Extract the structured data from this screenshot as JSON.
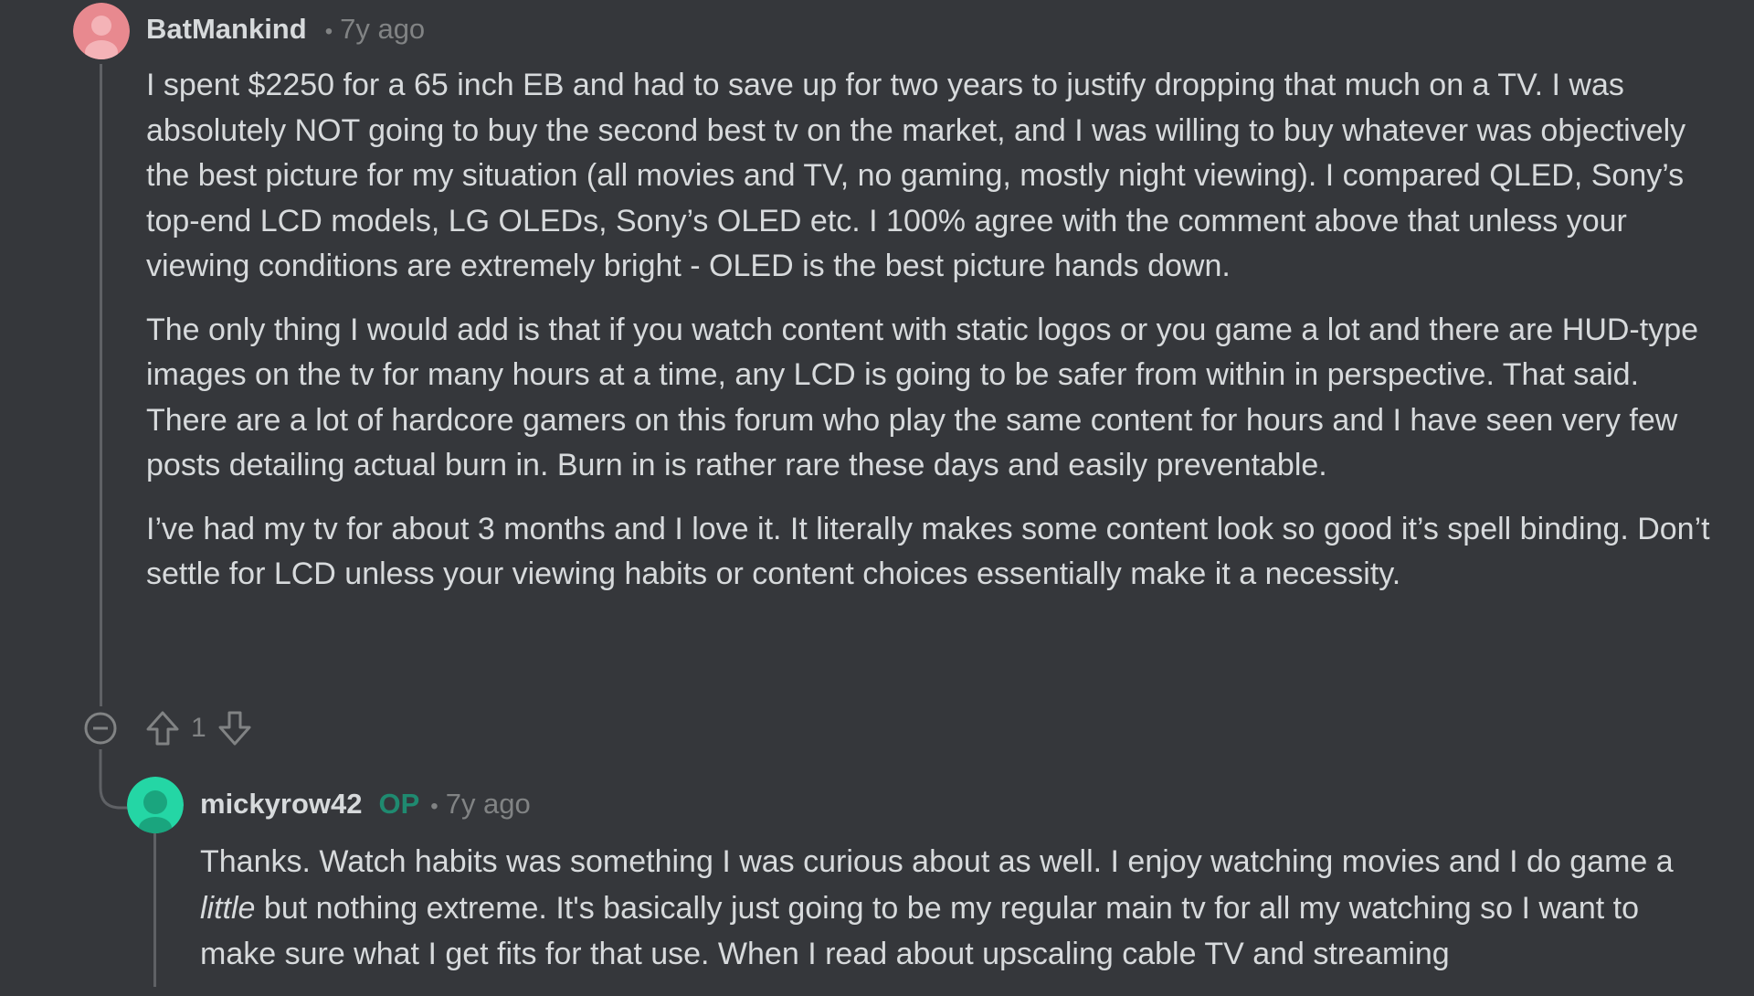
{
  "comments": [
    {
      "author": "BatMankind",
      "time": "7y ago",
      "paragraphs": [
        "I spent $2250 for a 65 inch EB and had to save up for two years to justify dropping that much on a TV. I was absolutely NOT going to buy the second best tv on the market, and I was willing to buy whatever was objectively the best picture for my situation (all movies and TV, no gaming, mostly night viewing). I compared QLED, Sony’s top-end LCD models, LG OLEDs, Sony’s OLED etc. I 100% agree with the comment above that unless your viewing conditions are extremely bright - OLED is the best picture hands down.",
        "The only thing I would add is that if you watch content with static logos or you game a lot and there are HUD-type images on the tv for many hours at a time, any LCD is going to be safer from within in perspective. That said. There are a lot of hardcore gamers on this forum who play the same content for hours and I have seen very few posts detailing actual burn in. Burn in is rather rare these days and easily preventable.",
        "I’ve had my tv for about 3 months and I love it. It literally makes some content look so good it’s spell binding. Don’t settle for LCD unless your viewing habits or content choices essentially make it a necessity."
      ],
      "votes": "1",
      "avatar_color": "#e8898f",
      "icons": {
        "collapse": "collapse-minus-icon",
        "upvote": "upvote-arrow-icon",
        "downvote": "downvote-arrow-icon"
      }
    },
    {
      "author": "mickyrow42",
      "op_badge": "OP",
      "time": "7y ago",
      "text_before_italic": "Thanks. Watch habits was something I was curious about as well. I enjoy watching movies and I do game a ",
      "italic": "little",
      "text_after_italic": " but nothing extreme. It's basically just going to be my regular main tv for all my watching so I want to make sure what I get fits for that use. When I read about upscaling cable TV and streaming",
      "avatar_color": "#24d6a5"
    }
  ],
  "colors": {
    "background": "#35373b",
    "text": "#d7dadc",
    "meta": "#818384",
    "op": "#1f8a70",
    "thread_line": "#5f6165"
  }
}
